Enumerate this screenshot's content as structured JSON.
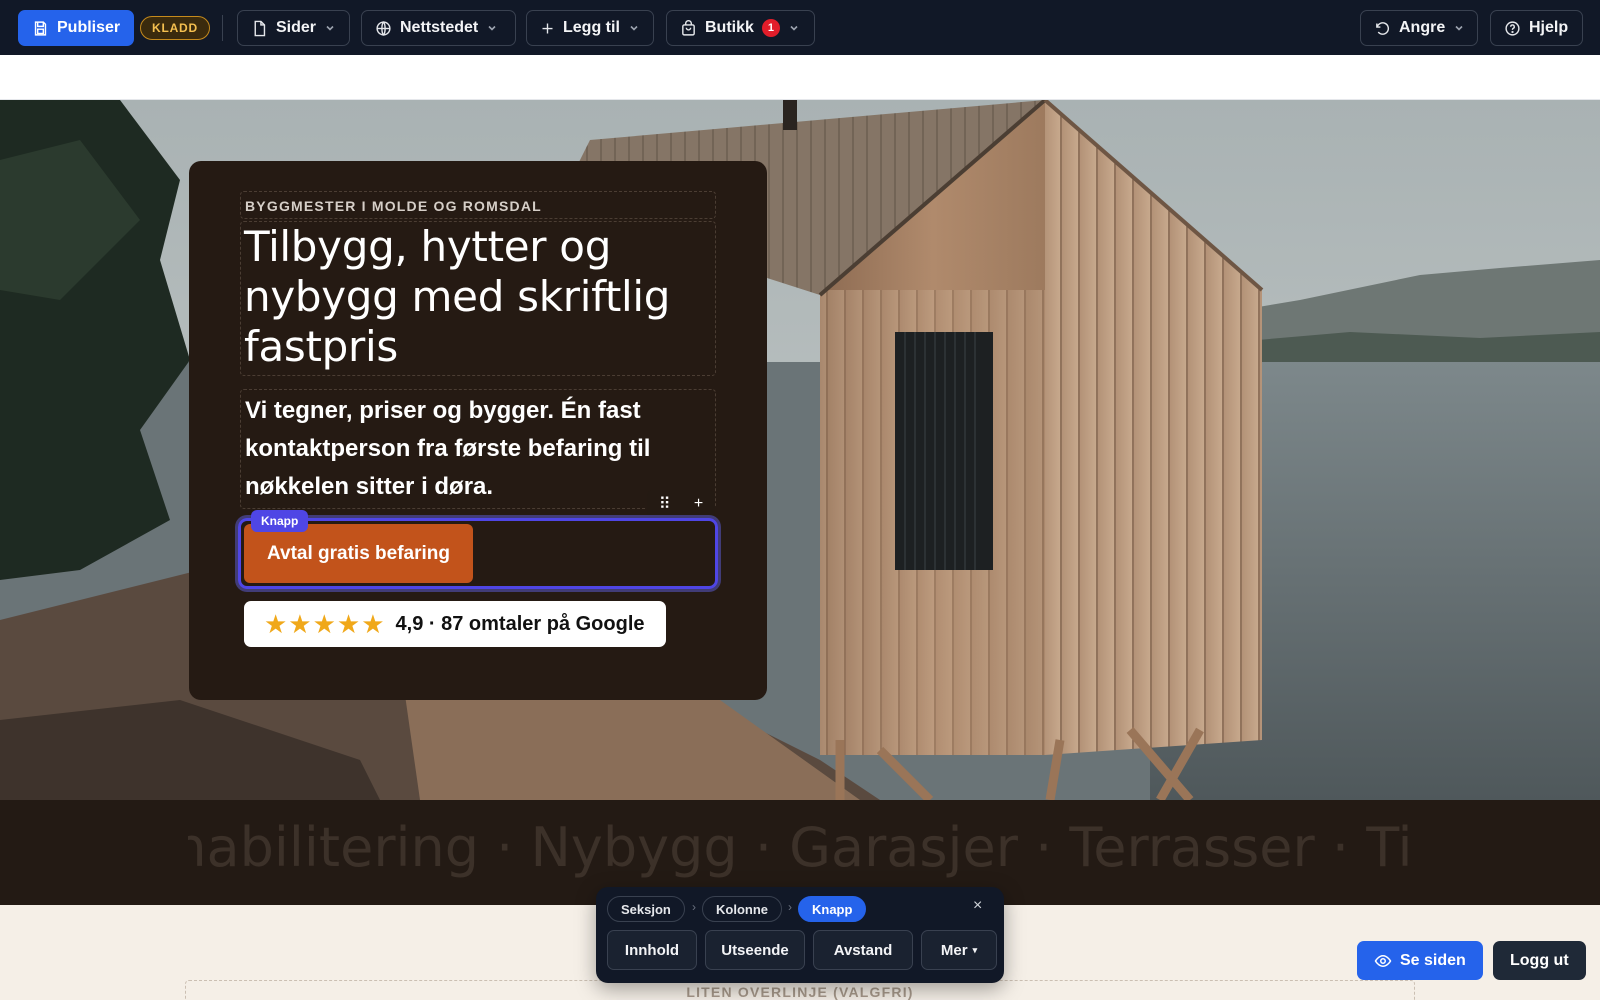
{
  "toolbar": {
    "publish_label": "Publiser",
    "draft_badge": "KLADD",
    "pages_label": "Sider",
    "website_label": "Nettstedet",
    "add_label": "Legg til",
    "shop_label": "Butikk",
    "shop_count": "1",
    "undo_label": "Angre",
    "help_label": "Hjelp"
  },
  "hero": {
    "overline": "BYGGMESTER I MOLDE OG ROMSDAL",
    "title": "Tilbygg, hytter og nybygg med skriftlig fastpris",
    "text": "Vi tegner, priser og bygger. Én fast kontaktperson fra første befaring til nøkkelen sitter i døra.",
    "mini_toolbar": {
      "drag": "⠿",
      "add": "+"
    },
    "selected_tag": "Knapp",
    "cta_label": "Avtal gratis befaring",
    "rating": {
      "stars": "★★★★★",
      "text": "4,9 · 87 omtaler på Google"
    }
  },
  "marquee": {
    "text": "Rehabilitering · Nybygg · Garasjer · Terrasser · Tilbygg · Rehabilitering"
  },
  "lower": {
    "overline": "LITEN OVERLINJE (VALGFRI)"
  },
  "context_toolbar": {
    "crumbs": [
      "Seksjon",
      "Kolonne",
      "Knapp"
    ],
    "separator": "›",
    "close": "×",
    "buttons": [
      "Innhold",
      "Utseende",
      "Avstand",
      "Mer"
    ],
    "more_caret": "▾"
  },
  "bottom_actions": {
    "view_label": "Se siden",
    "logout_label": "Logg ut"
  },
  "colors": {
    "accent": "#2563eb",
    "selection": "#4f46e5",
    "cta": "#c2531b",
    "card_bg": "#251a13",
    "toolbar_bg": "#111827",
    "star": "#f0a81a"
  }
}
